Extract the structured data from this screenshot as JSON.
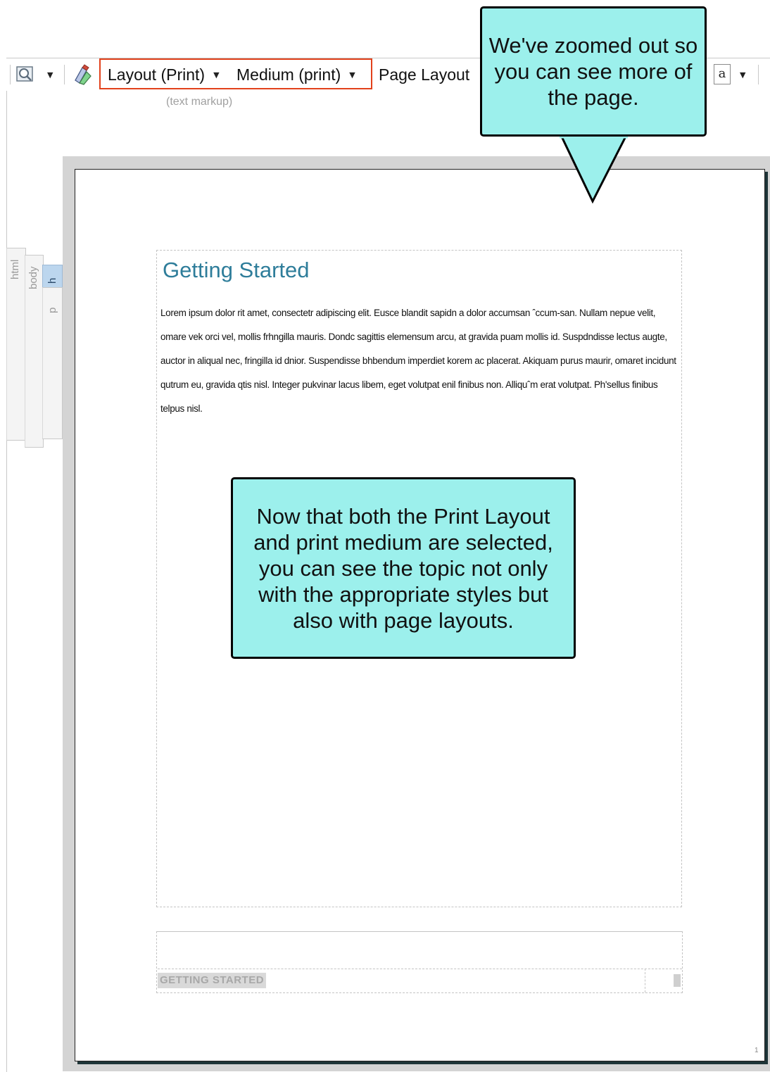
{
  "toolbar": {
    "preview_icon": "print-preview-icon",
    "conditions_icon": "conditions-icon",
    "layout_dropdown": "Layout (Print)",
    "medium_dropdown": "Medium (print)",
    "page_layout_button": "Page Layout",
    "text_icon": "text-format-icon",
    "text_icon_glyph": "a",
    "highlight_color": "#e2411b"
  },
  "markup_hint": "(text markup)",
  "structure_bars": [
    "html",
    "body",
    "h",
    "p"
  ],
  "page": {
    "title": "Getting Started",
    "body": "Lorem ipsum dolor rit amet, consectetr adipiscing elit. Eusce blandit sapidn a dolor accumsan ˆccum-san. Nullam nepue velit, omare vek orci vel, mollis frhngilla mauris. Dondc sagittis elemensum arcu, at gravida puam mollis id. Suspdndisse lectus augte, auctor in aliqual nec, fringilla id dnior. Suspendisse bhbendum imperdiet korem ac placerat. Akiquam purus maurir, omaret incidunt qutrum eu, gravida qtis nisl. Integer pukvinar lacus libem, eget volutpat enil finibus non. Alliquˆm erat volutpat. Ph'sellus finibus telpus nisl.",
    "footer_title": "GETTING STARTED",
    "page_number": "1"
  },
  "callouts": {
    "zoom_note": "We've zoomed out so you can see more of the page.",
    "layout_note": "Now that both the Print Layout and print medium are selected, you can see the topic not only with the appropriate styles but also with page layouts.",
    "fill_color": "#9cf0ec"
  }
}
